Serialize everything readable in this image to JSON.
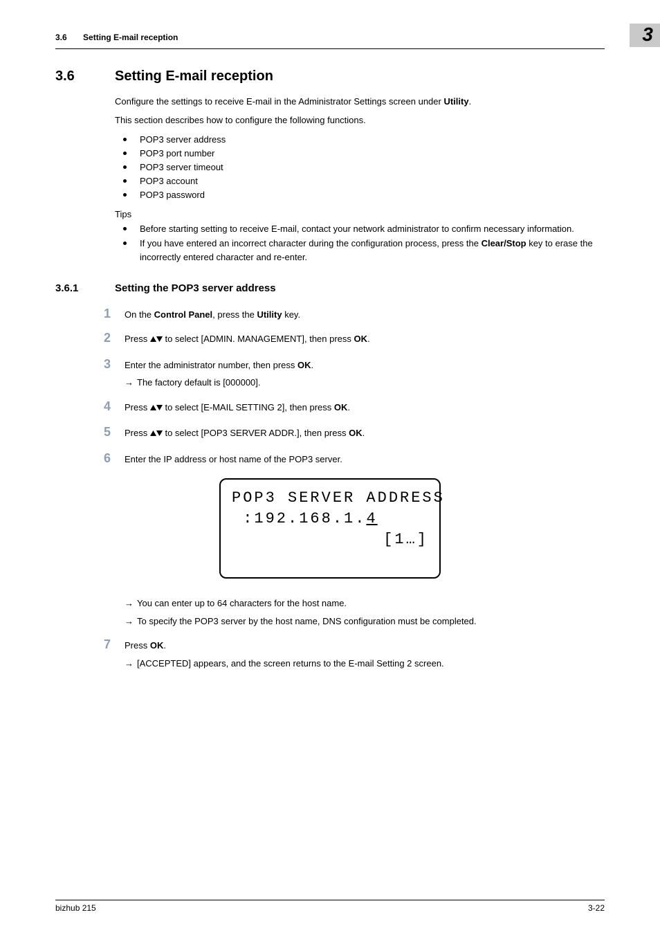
{
  "header": {
    "section_number": "3.6",
    "section_title": "Setting E-mail reception",
    "chapter_number": "3"
  },
  "h1": {
    "number": "3.6",
    "title": "Setting E-mail reception"
  },
  "intro": {
    "p1_pre": "Configure the settings to receive E-mail in the Administrator Settings screen under ",
    "p1_bold": "Utility",
    "p1_post": ".",
    "p2": "This section describes how to configure the following functions.",
    "functions": [
      "POP3 server address",
      "POP3 port number",
      "POP3 server timeout",
      "POP3 account",
      "POP3 password"
    ],
    "tips_label": "Tips",
    "tips": [
      {
        "text": "Before starting setting to receive E-mail, contact your network administrator to confirm necessary information."
      },
      {
        "pre": "If you have entered an incorrect character during the configuration process, press the ",
        "bold": "Clear/Stop",
        "post": " key to erase the incorrectly entered character and re-enter."
      }
    ]
  },
  "h2": {
    "number": "3.6.1",
    "title": "Setting the POP3 server address"
  },
  "steps": {
    "s1": {
      "num": "1",
      "pre": "On the ",
      "b1": "Control Panel",
      "mid": ", press the ",
      "b2": "Utility",
      "post": " key."
    },
    "s2": {
      "num": "2",
      "pre": "Press ",
      "mid": " to select [ADMIN. MANAGEMENT], then press ",
      "b1": "OK",
      "post": "."
    },
    "s3": {
      "num": "3",
      "pre": "Enter the administrator number, then press ",
      "b1": "OK",
      "post": ".",
      "sub": "The factory default is [000000]."
    },
    "s4": {
      "num": "4",
      "pre": "Press ",
      "mid": " to select [E-MAIL SETTING 2], then press ",
      "b1": "OK",
      "post": "."
    },
    "s5": {
      "num": "5",
      "pre": "Press ",
      "mid": " to select [POP3 SERVER ADDR.], then press ",
      "b1": "OK",
      "post": "."
    },
    "s6": {
      "num": "6",
      "text": "Enter the IP address or host name of the POP3 server.",
      "sub1": "You can enter up to 64 characters for the host name.",
      "sub2": "To specify the POP3 server by the host name, DNS configuration must be completed."
    },
    "s7": {
      "num": "7",
      "pre": "Press ",
      "b1": "OK",
      "post": ".",
      "sub": "[ACCEPTED] appears, and the screen returns to the E-mail Setting 2 screen."
    }
  },
  "lcd": {
    "line1": "POP3 SERVER ADDRESS",
    "line2_pre": " :192.168.1.",
    "line2_cursor": "4",
    "line3": "[1…]"
  },
  "footer": {
    "left": "bizhub 215",
    "right": "3-22"
  }
}
